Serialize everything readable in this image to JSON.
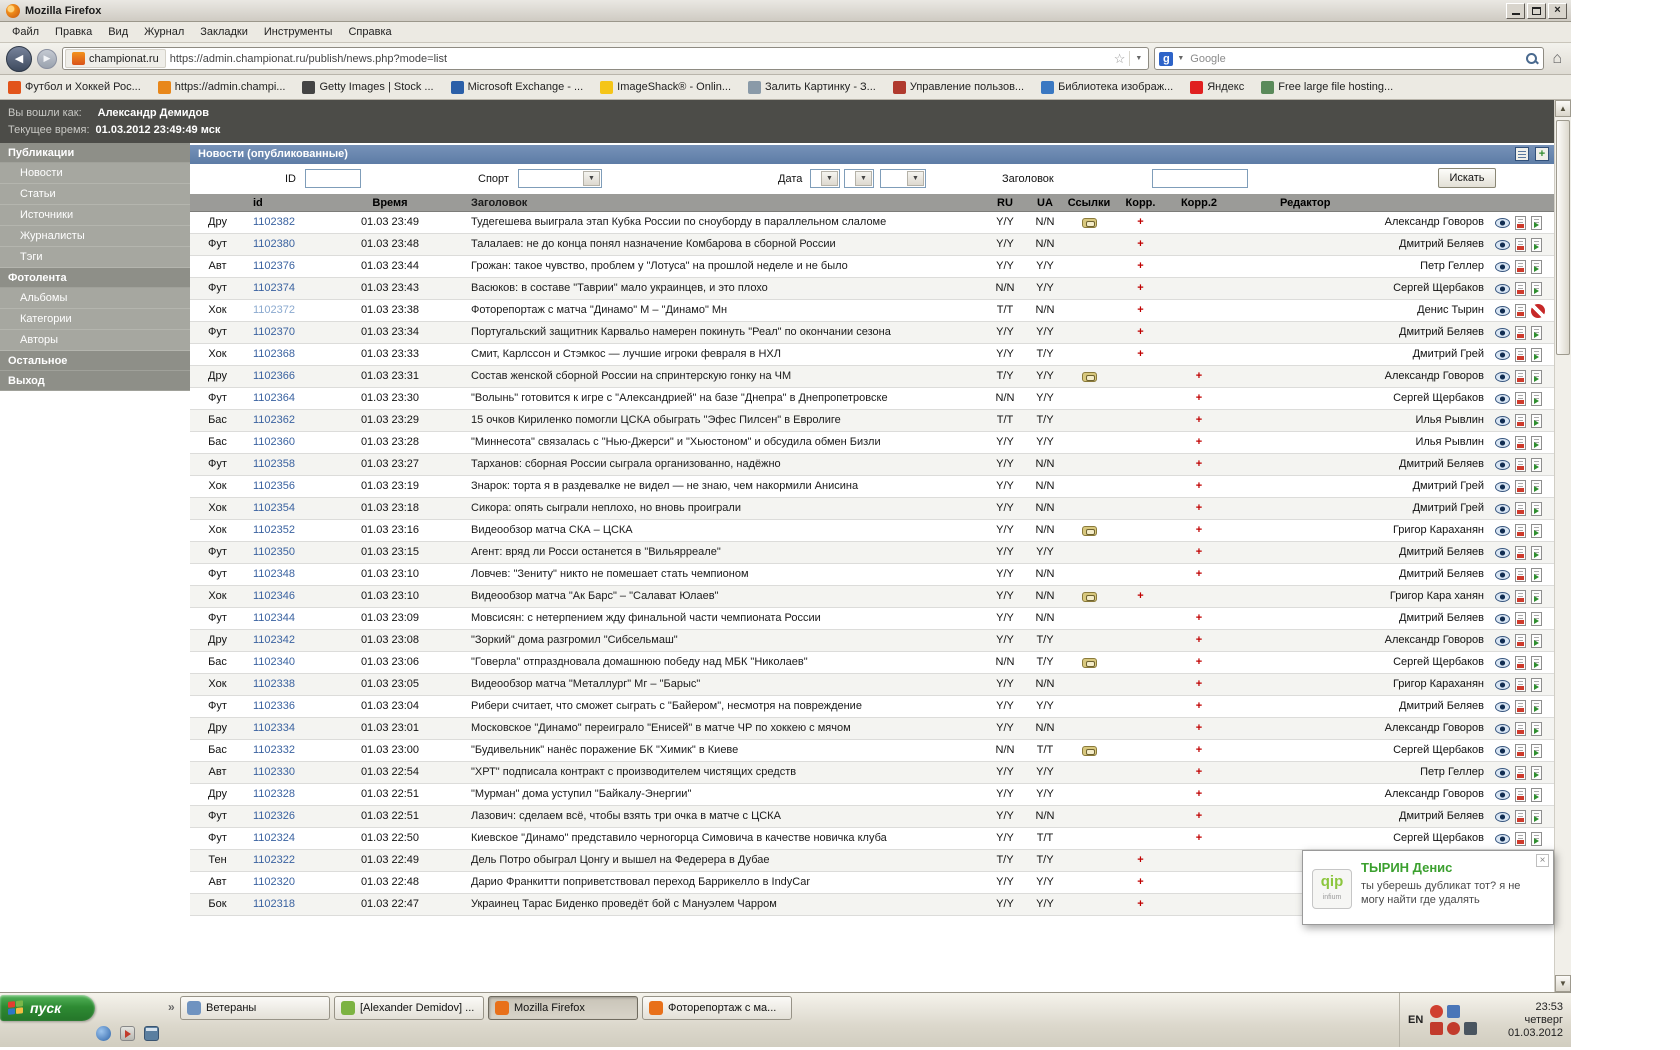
{
  "window": {
    "title": "Mozilla Firefox"
  },
  "menu": [
    "Файл",
    "Правка",
    "Вид",
    "Журнал",
    "Закладки",
    "Инструменты",
    "Справка"
  ],
  "navbar": {
    "site": "championat.ru",
    "url": "https://admin.championat.ru/publish/news.php?mode=list",
    "search_engine": "Google"
  },
  "bookmarks": [
    {
      "label": "Футбол и Хоккей Рос...",
      "color": "#E2541A"
    },
    {
      "label": "https://admin.champi...",
      "color": "#E8871A"
    },
    {
      "label": "Getty Images | Stock ...",
      "color": "#444444"
    },
    {
      "label": "Microsoft Exchange - ...",
      "color": "#2B5FA8"
    },
    {
      "label": "ImageShack® - Onlin...",
      "color": "#F5C518"
    },
    {
      "label": "Залить Картинку - З...",
      "color": "#8A9AA8"
    },
    {
      "label": "Управление пользов...",
      "color": "#B03A2E"
    },
    {
      "label": "Библиотека изображ...",
      "color": "#3A78C2"
    },
    {
      "label": "Яндекс",
      "color": "#E02020"
    },
    {
      "label": "Free large file hosting...",
      "color": "#5A8A5A"
    }
  ],
  "header": {
    "login_label": "Вы вошли как:",
    "login_value": "Александр Демидов",
    "time_label": "Текущее время:",
    "time_value": "01.03.2012 23:49:49 мск"
  },
  "sidebar": [
    {
      "label": "Публикации",
      "header": true
    },
    {
      "label": "Новости"
    },
    {
      "label": "Статьи"
    },
    {
      "label": "Источники"
    },
    {
      "label": "Журналисты"
    },
    {
      "label": "Тэги"
    },
    {
      "label": "Фотолента",
      "header": true
    },
    {
      "label": "Альбомы"
    },
    {
      "label": "Категории"
    },
    {
      "label": "Авторы"
    },
    {
      "label": "Остальное",
      "header": true
    },
    {
      "label": "Выход",
      "header": true
    }
  ],
  "content": {
    "title": "Новости (опубликованные)",
    "filters": {
      "id_label": "ID",
      "sport_label": "Спорт",
      "date_label": "Дата",
      "title_label": "Заголовок",
      "search_button": "Искать"
    },
    "table": {
      "headers": {
        "id": "id",
        "time": "Время",
        "title": "Заголовок",
        "ru": "RU",
        "ua": "UA",
        "links": "Ссылки",
        "korr": "Корр.",
        "korr2": "Корр.2",
        "editor": "Редактор"
      },
      "rows": [
        {
          "type": "Дру",
          "id": "1102382",
          "time": "01.03 23:49",
          "title": "Тудегешева выиграла этап Кубка России по сноуборду в параллельном слаломе",
          "ru": "Y/Y",
          "ua": "N/N",
          "link": true,
          "korr": "+",
          "korr2": "",
          "editor": "Александр Говоров"
        },
        {
          "type": "Фут",
          "id": "1102380",
          "time": "01.03 23:48",
          "title": "Талалаев: не до конца понял назначение Комбарова в сборной России",
          "ru": "Y/Y",
          "ua": "N/N",
          "link": false,
          "korr": "+",
          "korr2": "",
          "editor": "Дмитрий Беляев"
        },
        {
          "type": "Авт",
          "id": "1102376",
          "time": "01.03 23:44",
          "title": "Грожан: такое чувство, проблем у \"Лотуса\" на прошлой неделе и не было",
          "ru": "Y/Y",
          "ua": "Y/Y",
          "link": false,
          "korr": "+",
          "korr2": "",
          "editor": "Петр Геллер"
        },
        {
          "type": "Фут",
          "id": "1102374",
          "time": "01.03 23:43",
          "title": "Васюков: в составе \"Таврии\" мало украинцев, и это плохо",
          "ru": "N/N",
          "ua": "Y/Y",
          "link": false,
          "korr": "+",
          "korr2": "",
          "editor": "Сергей Щербаков"
        },
        {
          "type": "Хок",
          "id": "1102372",
          "time": "01.03 23:38",
          "title": "Фоторепортаж с матча \"Динамо\" М – \"Динамо\" Мн",
          "ru": "T/T",
          "ua": "N/N",
          "link": false,
          "korr": "+",
          "korr2": "",
          "editor": "Денис Тырин",
          "visited": true,
          "blocked": true
        },
        {
          "type": "Фут",
          "id": "1102370",
          "time": "01.03 23:34",
          "title": "Португальский защитник Карвальо намерен покинуть \"Реал\" по окончании сезона",
          "ru": "Y/Y",
          "ua": "Y/Y",
          "link": false,
          "korr": "+",
          "korr2": "",
          "editor": "Дмитрий Беляев"
        },
        {
          "type": "Хок",
          "id": "1102368",
          "time": "01.03 23:33",
          "title": "Смит, Карлссон и Стэмкос — лучшие игроки февраля в НХЛ",
          "ru": "Y/Y",
          "ua": "T/Y",
          "link": false,
          "korr": "+",
          "korr2": "",
          "editor": "Дмитрий Грей"
        },
        {
          "type": "Дру",
          "id": "1102366",
          "time": "01.03 23:31",
          "title": "Состав женской сборной России на спринтерскую гонку на ЧМ",
          "ru": "T/Y",
          "ua": "Y/Y",
          "link": true,
          "korr": "",
          "korr2": "+",
          "editor": "Александр Говоров"
        },
        {
          "type": "Фут",
          "id": "1102364",
          "time": "01.03 23:30",
          "title": "\"Волынь\" готовится к игре с \"Александрией\" на базе \"Днепра\" в Днепропетровске",
          "ru": "N/N",
          "ua": "Y/Y",
          "link": false,
          "korr": "",
          "korr2": "+",
          "editor": "Сергей Щербаков"
        },
        {
          "type": "Бас",
          "id": "1102362",
          "time": "01.03 23:29",
          "title": "15 очков Кириленко помогли ЦСКА обыграть \"Эфес Пилсен\" в Евролиге",
          "ru": "T/T",
          "ua": "T/Y",
          "link": false,
          "korr": "",
          "korr2": "+",
          "editor": "Илья Рывлин"
        },
        {
          "type": "Бас",
          "id": "1102360",
          "time": "01.03 23:28",
          "title": "\"Миннесота\" связалась с \"Нью-Джерси\" и \"Хьюстоном\" и обсудила обмен Бизли",
          "ru": "Y/Y",
          "ua": "Y/Y",
          "link": false,
          "korr": "",
          "korr2": "+",
          "editor": "Илья Рывлин"
        },
        {
          "type": "Фут",
          "id": "1102358",
          "time": "01.03 23:27",
          "title": "Тарханов: сборная России сыграла организованно, надёжно",
          "ru": "Y/Y",
          "ua": "N/N",
          "link": false,
          "korr": "",
          "korr2": "+",
          "editor": "Дмитрий Беляев"
        },
        {
          "type": "Хок",
          "id": "1102356",
          "time": "01.03 23:19",
          "title": "Знарок: торта я в раздевалке не видел — не знаю, чем накормили Анисина",
          "ru": "Y/Y",
          "ua": "N/N",
          "link": false,
          "korr": "",
          "korr2": "+",
          "editor": "Дмитрий Грей"
        },
        {
          "type": "Хок",
          "id": "1102354",
          "time": "01.03 23:18",
          "title": "Сикора: опять сыграли неплохо, но вновь проиграли",
          "ru": "Y/Y",
          "ua": "N/N",
          "link": false,
          "korr": "",
          "korr2": "+",
          "editor": "Дмитрий Грей"
        },
        {
          "type": "Хок",
          "id": "1102352",
          "time": "01.03 23:16",
          "title": "Видеообзор матча СКА – ЦСКА",
          "ru": "Y/Y",
          "ua": "N/N",
          "link": true,
          "korr": "",
          "korr2": "+",
          "editor": "Григор Караханян"
        },
        {
          "type": "Фут",
          "id": "1102350",
          "time": "01.03 23:15",
          "title": "Агент: вряд ли Росси останется в \"Вильярреале\"",
          "ru": "Y/Y",
          "ua": "Y/Y",
          "link": false,
          "korr": "",
          "korr2": "+",
          "editor": "Дмитрий Беляев"
        },
        {
          "type": "Фут",
          "id": "1102348",
          "time": "01.03 23:10",
          "title": "Ловчев: \"Зениту\" никто не помешает стать чемпионом",
          "ru": "Y/Y",
          "ua": "N/N",
          "link": false,
          "korr": "",
          "korr2": "+",
          "editor": "Дмитрий Беляев"
        },
        {
          "type": "Хок",
          "id": "1102346",
          "time": "01.03 23:10",
          "title": "Видеообзор матча \"Ак Барс\" – \"Салават Юлаев\"",
          "ru": "Y/Y",
          "ua": "N/N",
          "link": true,
          "korr": "+",
          "korr2": "",
          "editor": "Григор Кара ханян"
        },
        {
          "type": "Фут",
          "id": "1102344",
          "time": "01.03 23:09",
          "title": "Мовсисян: с нетерпением жду финальной части чемпионата России",
          "ru": "Y/Y",
          "ua": "N/N",
          "link": false,
          "korr": "",
          "korr2": "+",
          "editor": "Дмитрий Беляев"
        },
        {
          "type": "Дру",
          "id": "1102342",
          "time": "01.03 23:08",
          "title": "\"Зоркий\" дома разгромил \"Сибсельмаш\"",
          "ru": "Y/Y",
          "ua": "T/Y",
          "link": false,
          "korr": "",
          "korr2": "+",
          "editor": "Александр Говоров"
        },
        {
          "type": "Бас",
          "id": "1102340",
          "time": "01.03 23:06",
          "title": "\"Говерла\" отпраздновала домашнюю победу над МБК \"Николаев\"",
          "ru": "N/N",
          "ua": "T/Y",
          "link": true,
          "korr": "",
          "korr2": "+",
          "editor": "Сергей Щербаков"
        },
        {
          "type": "Хок",
          "id": "1102338",
          "time": "01.03 23:05",
          "title": "Видеообзор матча \"Металлург\" Мг – \"Барыс\"",
          "ru": "Y/Y",
          "ua": "N/N",
          "link": false,
          "korr": "",
          "korr2": "+",
          "editor": "Григор Караханян"
        },
        {
          "type": "Фут",
          "id": "1102336",
          "time": "01.03 23:04",
          "title": "Рибери считает, что сможет сыграть с \"Байером\", несмотря на повреждение",
          "ru": "Y/Y",
          "ua": "Y/Y",
          "link": false,
          "korr": "",
          "korr2": "+",
          "editor": "Дмитрий Беляев"
        },
        {
          "type": "Дру",
          "id": "1102334",
          "time": "01.03 23:01",
          "title": "Московское \"Динамо\" переиграло \"Енисей\" в матче ЧР по хоккею с мячом",
          "ru": "Y/Y",
          "ua": "N/N",
          "link": false,
          "korr": "",
          "korr2": "+",
          "editor": "Александр Говоров"
        },
        {
          "type": "Бас",
          "id": "1102332",
          "time": "01.03 23:00",
          "title": "\"Будивельник\" нанёс поражение БК \"Химик\" в Киеве",
          "ru": "N/N",
          "ua": "T/T",
          "link": true,
          "korr": "",
          "korr2": "+",
          "editor": "Сергей Щербаков"
        },
        {
          "type": "Авт",
          "id": "1102330",
          "time": "01.03 22:54",
          "title": "\"ХРТ\" подписала контракт с производителем чистящих средств",
          "ru": "Y/Y",
          "ua": "Y/Y",
          "link": false,
          "korr": "",
          "korr2": "+",
          "editor": "Петр Геллер"
        },
        {
          "type": "Дру",
          "id": "1102328",
          "time": "01.03 22:51",
          "title": "\"Мурман\" дома уступил \"Байкалу-Энергии\"",
          "ru": "Y/Y",
          "ua": "Y/Y",
          "link": false,
          "korr": "",
          "korr2": "+",
          "editor": "Александр Говоров"
        },
        {
          "type": "Фут",
          "id": "1102326",
          "time": "01.03 22:51",
          "title": "Лазович: сделаем всё, чтобы взять три очка в матче с ЦСКА",
          "ru": "Y/Y",
          "ua": "N/N",
          "link": false,
          "korr": "",
          "korr2": "+",
          "editor": "Дмитрий Беляев"
        },
        {
          "type": "Фут",
          "id": "1102324",
          "time": "01.03 22:50",
          "title": "Киевское \"Динамо\" представило черногорца Симовича в качестве новичка клуба",
          "ru": "Y/Y",
          "ua": "T/T",
          "link": false,
          "korr": "",
          "korr2": "+",
          "editor": "Сергей Щербаков"
        },
        {
          "type": "Тен",
          "id": "1102322",
          "time": "01.03 22:49",
          "title": "Дель Потро обыграл Цонгу и вышел на Федерера в Дубае",
          "ru": "T/Y",
          "ua": "T/Y",
          "link": false,
          "korr": "+",
          "korr2": "",
          "editor": ""
        },
        {
          "type": "Авт",
          "id": "1102320",
          "time": "01.03 22:48",
          "title": "Дарио Франкитти поприветствовал переход Баррикелло в IndyCar",
          "ru": "Y/Y",
          "ua": "Y/Y",
          "link": false,
          "korr": "+",
          "korr2": "",
          "editor": ""
        },
        {
          "type": "Бок",
          "id": "1102318",
          "time": "01.03 22:47",
          "title": "Украинец Тарас Биденко проведёт бой с Мануэлем Чарром",
          "ru": "Y/Y",
          "ua": "Y/Y",
          "link": false,
          "korr": "+",
          "korr2": "",
          "editor": ""
        }
      ]
    }
  },
  "notification": {
    "title": "ТЫРИН Денис",
    "message": "ты уберешь дубликат тот? я не могу найти где удалять",
    "logo_text": "qip",
    "logo_sub": "infium"
  },
  "taskbar": {
    "start": "пуск",
    "tasks": [
      {
        "label": "Ветераны",
        "color": "#6F93C0",
        "active": false
      },
      {
        "label": "[Alexander Demidov] ...",
        "color": "#7CB342",
        "active": false
      },
      {
        "label": "Mozilla Firefox",
        "color": "#E8701A",
        "active": true
      },
      {
        "label": "Фоторепортаж с ма...",
        "color": "#E8701A",
        "active": false
      }
    ],
    "tray": {
      "lang": "EN",
      "time": "23:53",
      "day": "четверг",
      "date": "01.03.2012"
    }
  }
}
